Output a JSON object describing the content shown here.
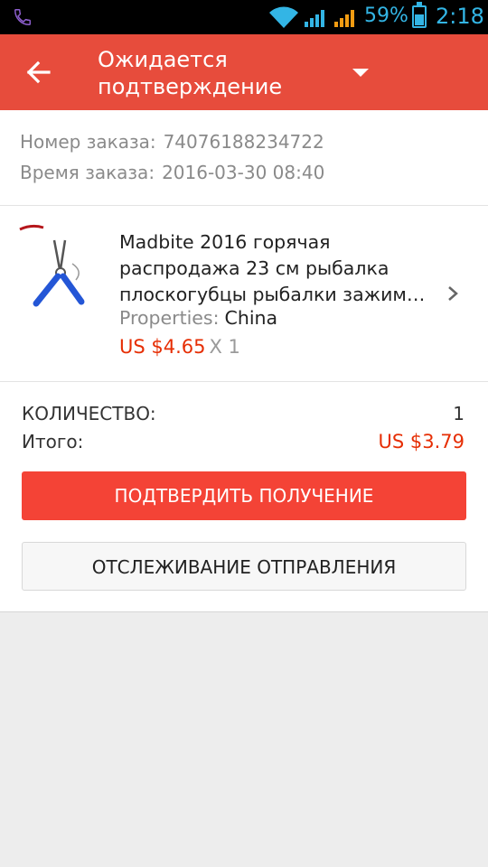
{
  "status_bar": {
    "battery_percent": "59%",
    "time": "2:18"
  },
  "app_bar": {
    "title_line1": "Ожидается",
    "title_line2": "подтверждение",
    "back_icon": "arrow-left-icon",
    "dropdown_icon": "caret-down-icon"
  },
  "order": {
    "number_label": "Номер заказа:",
    "number_value": "74076188234722",
    "time_label": "Время заказа:",
    "time_value": "2016-03-30 08:40"
  },
  "product": {
    "title": "Madbite 2016 горячая распродажа 23 см рыбалка плоскогубцы рыбалки зажим…",
    "properties_label": "Properties:",
    "properties_value": "China",
    "price": "US $4.65",
    "quantity": "X 1"
  },
  "summary": {
    "quantity_label": "КОЛИЧЕСТВО:",
    "quantity_value": "1",
    "total_label": "Итого:",
    "total_value": "US $3.79"
  },
  "buttons": {
    "confirm_label": "ПОДТВЕРДИТЬ ПОЛУЧЕНИЕ",
    "track_label": "ОТСЛЕЖИВАНИЕ ОТПРАВЛЕНИЯ"
  },
  "colors": {
    "accent": "#e74c3c",
    "price": "#e62e04",
    "status_icons": "#33b5e5"
  }
}
